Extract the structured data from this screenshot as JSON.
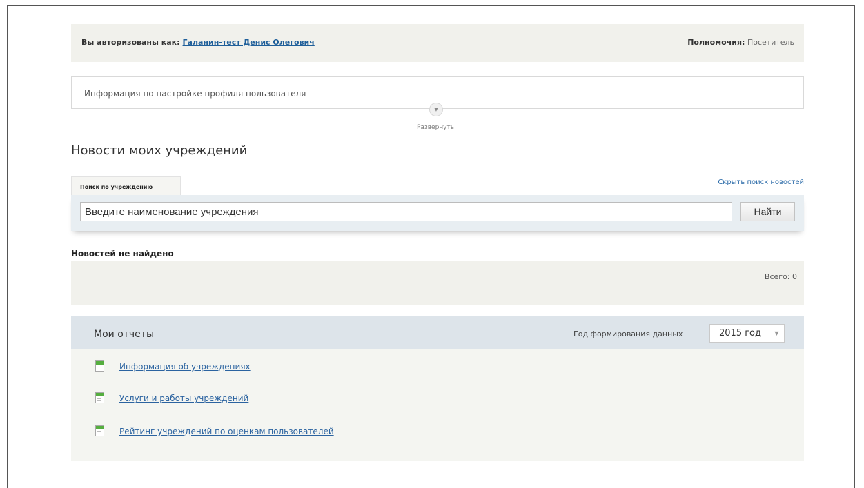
{
  "auth": {
    "prefix": "Вы авторизованы как:",
    "user_name": "Галанин-тест Денис Олегович",
    "role_label": "Полномочия:",
    "role_value": "Посетитель"
  },
  "profile": {
    "info_text": "Информация по настройке профиля пользователя",
    "expand_label": "Развернуть"
  },
  "news": {
    "title": "Новости моих учреждений",
    "search_tab": "Поиск по учреждению",
    "hide_search_link": "Скрыть поиск новостей",
    "search_placeholder": "Введите наименование учреждения",
    "search_value": "",
    "find_button": "Найти",
    "empty_message": "Новостей не найдено",
    "total_text": "Всего: 0"
  },
  "reports": {
    "title": "Мои отчеты",
    "year_label": "Год формирования данных",
    "year_value": "2015 год",
    "items": [
      {
        "label": "Информация об учреждениях",
        "icon": "report-doc-icon"
      },
      {
        "label": "Услуги и работы учреждений",
        "icon": "report-doc-icon"
      },
      {
        "label": "Рейтинг учреждений по оценкам пользователей",
        "icon": "report-doc-icon"
      }
    ]
  }
}
